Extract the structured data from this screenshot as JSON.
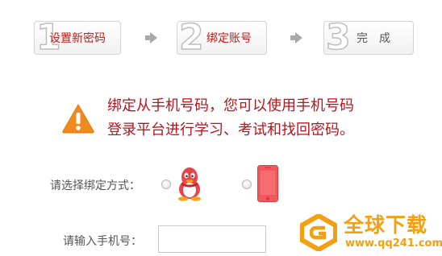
{
  "steps": [
    {
      "num": "1",
      "label": "设置新密码",
      "state": "done"
    },
    {
      "num": "2",
      "label": "绑定账号",
      "state": "active"
    },
    {
      "num": "3",
      "label": "完　成",
      "state": "pending"
    }
  ],
  "notice": {
    "line1": "绑定从手机号码，您可以使用手机号码",
    "line2": "登录平台进行学习、考试和找回密码。",
    "color": "#b5151c",
    "icon": "warning-icon"
  },
  "bind_method": {
    "label": "请选择绑定方式：",
    "options": [
      {
        "name": "qq",
        "icon": "qq-penguin-icon",
        "selected": false
      },
      {
        "name": "phone",
        "icon": "mobile-phone-icon",
        "selected": false
      }
    ]
  },
  "phone_input": {
    "label": "请输入手机号：",
    "value": ""
  },
  "watermark": {
    "brand": "全球下载",
    "url": "www.qq241.com",
    "color": "#f2a012"
  }
}
